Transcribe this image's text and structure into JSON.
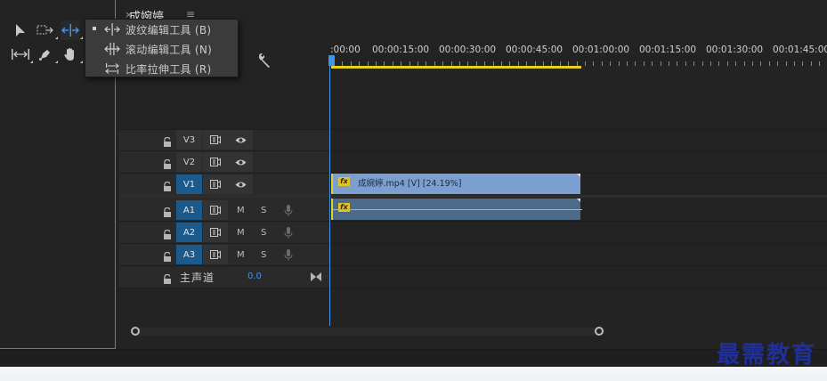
{
  "sequence": {
    "title": "成婉婷",
    "menu_glyph": "≡",
    "close_glyph": "×"
  },
  "tool_menu": {
    "items": [
      {
        "label": "波纹编辑工具 (B)",
        "checked": true,
        "icon": "ripple-edit-icon"
      },
      {
        "label": "滚动编辑工具 (N)",
        "checked": false,
        "icon": "rolling-edit-icon"
      },
      {
        "label": "比率拉伸工具 (R)",
        "checked": false,
        "icon": "rate-stretch-icon"
      }
    ]
  },
  "ruler": {
    "labels": [
      ":00:00",
      "00:00:15:00",
      "00:00:30:00",
      "00:00:45:00",
      "00:01:00:00",
      "00:01:15:00",
      "00:01:30:00",
      "00:01:45:00"
    ]
  },
  "tracks": {
    "video": [
      {
        "name": "V3",
        "targeted": false
      },
      {
        "name": "V2",
        "targeted": false
      },
      {
        "name": "V1",
        "targeted": true
      }
    ],
    "audio": [
      {
        "name": "A1",
        "targeted": true,
        "mute": "M",
        "solo": "S"
      },
      {
        "name": "A2",
        "targeted": true,
        "mute": "M",
        "solo": "S"
      },
      {
        "name": "A3",
        "targeted": true,
        "mute": "M",
        "solo": "S"
      }
    ],
    "master": {
      "label": "主声道",
      "value": "0.0"
    }
  },
  "clips": {
    "video": {
      "name": "成婉婷.mp4 [V] [24.19%]",
      "fx": "fx"
    },
    "audio": {
      "fx": "fx"
    }
  },
  "watermark": "最需教育",
  "colors": {
    "accent": "#3d95ee",
    "video_clip": "#7b9fcf",
    "audio_clip": "#4d6a89",
    "ruler_in_out": "#e8d21a",
    "fx_badge": "#e2c22a",
    "target": "#1c5a8c"
  }
}
